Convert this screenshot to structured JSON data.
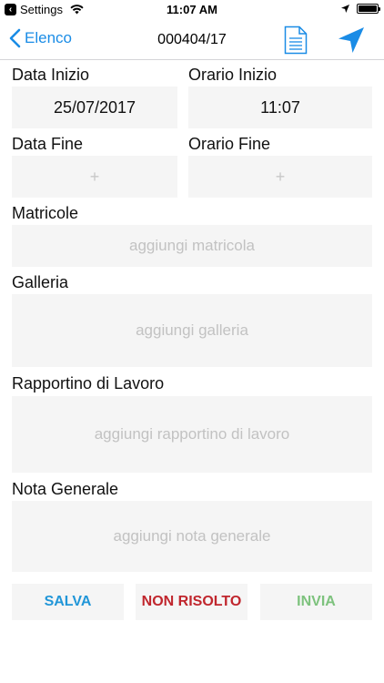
{
  "status": {
    "back_app_label": "Settings",
    "time": "11:07 AM"
  },
  "nav": {
    "back_label": "Elenco",
    "title": "000404/17"
  },
  "form": {
    "data_inizio": {
      "label": "Data Inizio",
      "value": "25/07/2017"
    },
    "orario_inizio": {
      "label": "Orario Inizio",
      "value": "11:07"
    },
    "data_fine": {
      "label": "Data Fine",
      "value": "+"
    },
    "orario_fine": {
      "label": "Orario Fine",
      "value": "+"
    },
    "matricole": {
      "label": "Matricole",
      "placeholder": "aggiungi matricola"
    },
    "galleria": {
      "label": "Galleria",
      "placeholder": "aggiungi galleria"
    },
    "rapportino": {
      "label": "Rapportino di Lavoro",
      "placeholder": "aggiungi rapportino di lavoro"
    },
    "nota": {
      "label": "Nota Generale",
      "placeholder": "aggiungi nota generale"
    }
  },
  "actions": {
    "salva": {
      "label": "SALVA",
      "color": "#2196d8"
    },
    "non_risolto": {
      "label": "NON RISOLTO",
      "color": "#c0262d"
    },
    "invia": {
      "label": "INVIA",
      "color": "#7dc27d"
    }
  },
  "colors": {
    "accent": "#1a8ce6",
    "field_bg": "#f5f5f5",
    "placeholder": "#c2c2c2"
  }
}
